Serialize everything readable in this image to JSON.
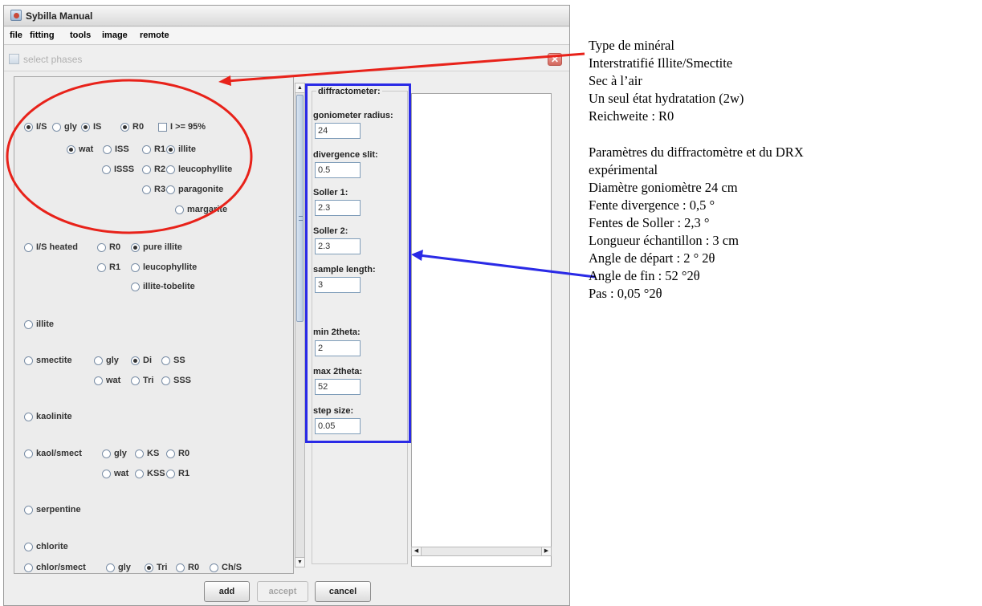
{
  "window": {
    "title": "Sybilla Manual"
  },
  "menu": [
    "file",
    "fitting",
    "tools",
    "image",
    "remote"
  ],
  "dialog": {
    "title": "select phases",
    "close_glyph": "✕"
  },
  "phases": {
    "is": {
      "type": "I/S",
      "gly": "gly",
      "is": "IS",
      "r0": "R0",
      "i95": "I >= 95%",
      "wat": "wat",
      "iss": "ISS",
      "r1": "R1",
      "illite": "illite",
      "isss": "ISSS",
      "r2": "R2",
      "leucophyllite": "leucophyllite",
      "r3": "R3",
      "paragonite": "paragonite",
      "margarite": "margarite"
    },
    "is_heated": {
      "type": "I/S heated",
      "r0": "R0",
      "pure_illite": "pure illite",
      "r1": "R1",
      "leucophyllite": "leucophyllite",
      "illite_tobelite": "illite-tobelite"
    },
    "illite": "illite",
    "smectite": {
      "type": "smectite",
      "gly": "gly",
      "di": "Di",
      "ss": "SS",
      "wat": "wat",
      "tri": "Tri",
      "sss": "SSS"
    },
    "kaolinite": "kaolinite",
    "kaol_smect": {
      "type": "kaol/smect",
      "gly": "gly",
      "ks": "KS",
      "r0": "R0",
      "wat": "wat",
      "kss": "KSS",
      "r1": "R1"
    },
    "serpentine": "serpentine",
    "chlorite": "chlorite",
    "chlor_smect": {
      "type": "chlor/smect",
      "gly": "gly",
      "tri": "Tri",
      "r0": "R0",
      "chs": "Ch/S"
    }
  },
  "diffractometer": {
    "title": "diffractometer:",
    "fields": [
      {
        "label": "goniometer radius:",
        "value": "24"
      },
      {
        "label": "divergence slit:",
        "value": "0.5"
      },
      {
        "label": "Soller 1:",
        "value": "2.3"
      },
      {
        "label": "Soller 2:",
        "value": "2.3"
      },
      {
        "label": "sample length:",
        "value": "3"
      },
      {
        "label": "min 2theta:",
        "value": "2"
      },
      {
        "label": "max 2theta:",
        "value": "52"
      },
      {
        "label": "step size:",
        "value": "0.05"
      }
    ]
  },
  "buttons": {
    "add": "add",
    "accept": "accept",
    "cancel": "cancel"
  },
  "annotations": {
    "mineral": [
      "Type de minéral",
      "Interstratifié Illite/Smectite",
      "Sec à l’air",
      "Un seul état hydratation (2w)",
      "Reichweite : R0"
    ],
    "diffractometer": [
      "Paramètres du diffractomètre et du DRX",
      "expérimental",
      "Diamètre goniomètre 24 cm",
      "Fente divergence : 0,5 °",
      "Fentes de Soller : 2,3 °",
      "Longueur échantillon : 3 cm",
      "Angle de départ : 2 ° 2θ",
      "Angle de fin : 52 °2θ",
      "Pas : 0,05 °2θ"
    ]
  },
  "colors": {
    "annotation_red": "#e8221a",
    "annotation_blue": "#2a2ae6"
  }
}
